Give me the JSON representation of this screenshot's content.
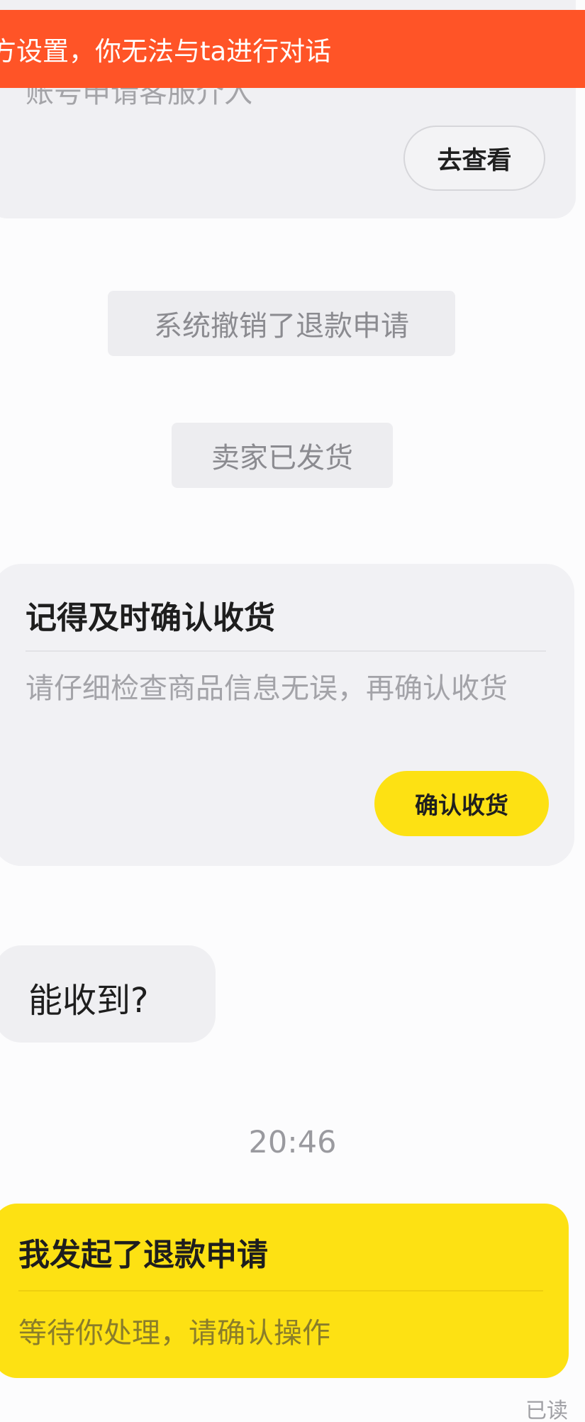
{
  "banner": {
    "text": "方设置，你无法与ta进行对话"
  },
  "top_card": {
    "partial_text": "账号申请客服介入",
    "view_button": "去查看"
  },
  "system_notices": [
    "系统撤销了退款申请",
    "卖家已发货"
  ],
  "receipt_card": {
    "title": "记得及时确认收货",
    "description": "请仔细检查商品信息无误，再确认收货",
    "confirm_button": "确认收货"
  },
  "incoming_message": {
    "text": "能收到?"
  },
  "timestamp": "20:46",
  "refund_card": {
    "title": "我发起了退款申请",
    "description": "等待你处理，请确认操作"
  },
  "read_status": "已读",
  "colors": {
    "banner": "#ff5427",
    "accent_yellow": "#fde113",
    "card_gray": "#f1f1f4"
  }
}
